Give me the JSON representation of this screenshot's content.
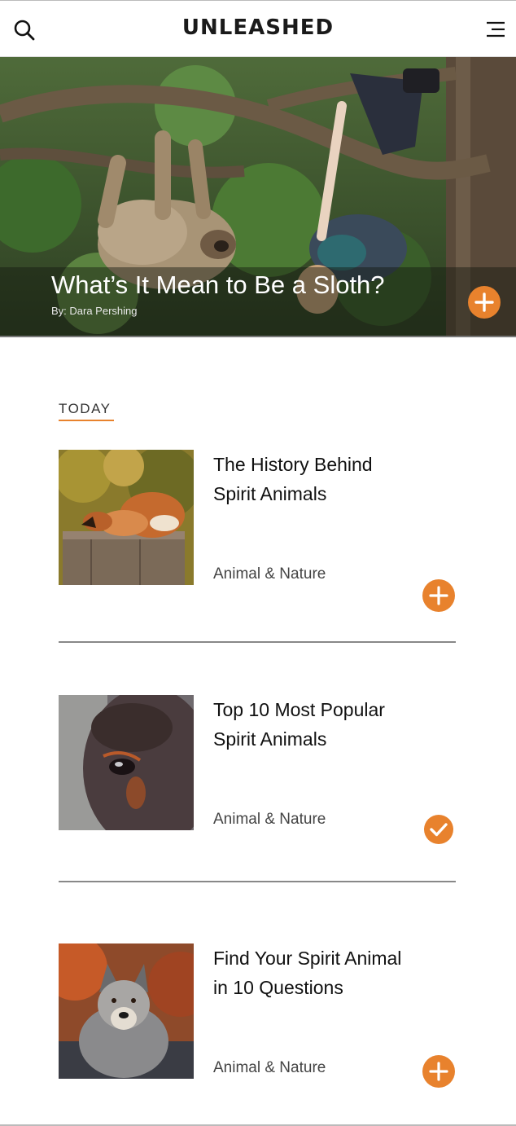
{
  "header": {
    "title": "UNLEASHED",
    "search_icon": "search-icon",
    "menu_icon": "hamburger-menu-icon"
  },
  "hero": {
    "headline": "What’s It Mean to Be a Sloth?",
    "byline": "By: Dara Pershing",
    "action_icon": "plus-icon"
  },
  "section": {
    "label": "TODAY"
  },
  "articles": [
    {
      "title_line1": "The History Behind",
      "title_line2": "Spirit Animals",
      "category": "Animal & Nature",
      "action_icon": "plus-icon",
      "thumbnail": "fox-sleeping-on-stump"
    },
    {
      "title_line1": "Top 10 Most Popular",
      "title_line2": "Spirit Animals",
      "category": "Animal & Nature",
      "action_icon": "check-icon",
      "thumbnail": "horse-eye-closeup"
    },
    {
      "title_line1": "Find Your Spirit Animal",
      "title_line2": "in 10 Questions",
      "category": "Animal & Nature",
      "action_icon": "plus-icon",
      "thumbnail": "wolf-portrait"
    }
  ],
  "colors": {
    "accent": "#e8822d",
    "text": "#111111",
    "divider": "#888888"
  }
}
